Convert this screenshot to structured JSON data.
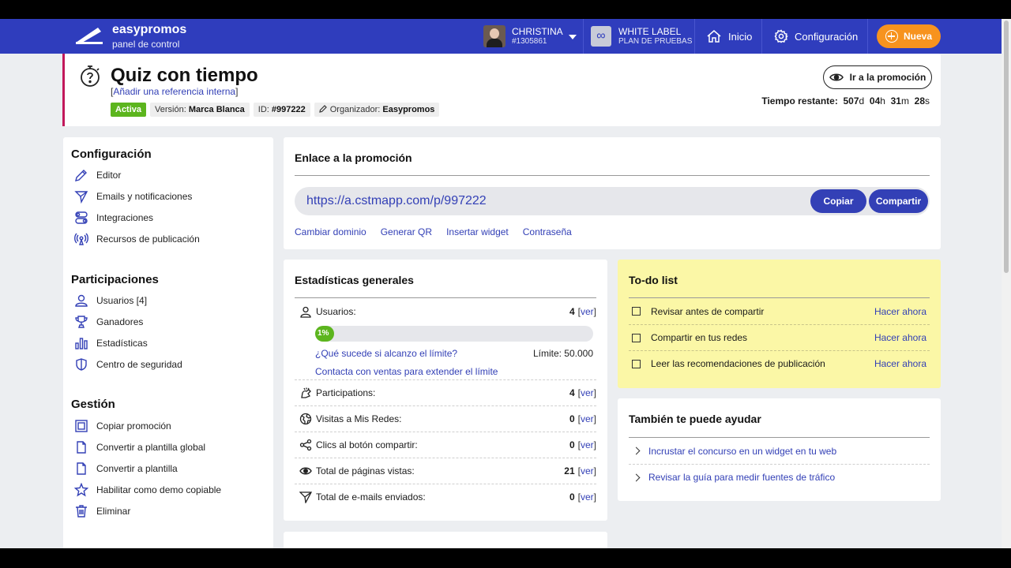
{
  "topbar": {
    "brand_name": "easypromos",
    "brand_sub": "panel de control",
    "user_name": "CHRISTINA",
    "user_id": "#1305861",
    "white_label_title": "WHITE LABEL",
    "white_label_sub": "PLAN DE PRUEBAS",
    "white_label_icon": "∞",
    "inicio": "Inicio",
    "configuracion": "Configuración",
    "nueva": "Nueva",
    "color_brand": "#2f3dbd",
    "color_accent": "#f7931e"
  },
  "promo": {
    "title": "Quiz con tiempo",
    "ref_open": "[",
    "ref_link": "Añadir una referencia interna",
    "ref_close": "]",
    "status": "Activa",
    "version_label": "Versión:",
    "version_value": "Marca Blanca",
    "id_label": "ID:",
    "id_value": "#997222",
    "org_label": "Organizador:",
    "org_value": "Easypromos",
    "go_button": "Ir a la promoción",
    "time_label": "Tiempo restante:",
    "time_days": "507",
    "time_days_unit": "d",
    "time_hours": "04",
    "time_hours_unit": "h",
    "time_minutes": "31",
    "time_minutes_unit": "m",
    "time_seconds": "28",
    "time_seconds_unit": "s"
  },
  "sidebar": {
    "sections": [
      {
        "title": "Configuración",
        "items": [
          "Editor",
          "Emails y notificaciones",
          "Integraciones",
          "Recursos de publicación"
        ]
      },
      {
        "title": "Participaciones",
        "items": [
          "Usuarios [4]",
          "Ganadores",
          "Estadísticas",
          "Centro de seguridad"
        ]
      },
      {
        "title": "Gestión",
        "items": [
          "Copiar promoción",
          "Convertir a plantilla global",
          "Convertir a plantilla",
          "Habilitar como demo copiable",
          "Eliminar"
        ]
      }
    ]
  },
  "link_card": {
    "title": "Enlace a la promoción",
    "url": "https://a.cstmapp.com/p/997222",
    "copy": "Copiar",
    "share": "Compartir",
    "actions": [
      "Cambiar dominio",
      "Generar QR",
      "Insertar widget",
      "Contraseña"
    ]
  },
  "stats": {
    "title": "Estadísticas generales",
    "users_label": "Usuarios:",
    "users_value": "4",
    "progress_percent": 1,
    "progress_label": "1%",
    "limit_question": "¿Qué sucede si alcanzo el límite?",
    "limit_label": "Límite: 50.000",
    "contact": "Contacta con ventas para extender el límite",
    "ver_open": "[",
    "ver_word": "ver",
    "ver_close": "]",
    "rows": [
      {
        "label": "Participations",
        "value": "4"
      }
    ],
    "participaciones_label": "Participations:",
    "participaciones_value": "4",
    "visitas_label": "Visitas a Mis Redes:",
    "visitas_value": "0",
    "clics_label": "Clics al botón compartir:",
    "clics_value": "0",
    "paginas_label": "Total de páginas vistas:",
    "paginas_value": "21",
    "emails_label": "Total de e-mails enviados:",
    "emails_value": "0"
  },
  "todo": {
    "title": "To-do list",
    "items": [
      {
        "label": "Revisar antes de compartir",
        "action": "Hacer ahora"
      },
      {
        "label": "Compartir en tus redes",
        "action": "Hacer ahora"
      },
      {
        "label": "Leer las recomendaciones de publicación",
        "action": "Hacer ahora"
      }
    ]
  },
  "help": {
    "title": "También te puede ayudar",
    "items": [
      "Incrustar el concurso en un widget en tu web",
      "Revisar la guía para medir fuentes de tráfico"
    ]
  }
}
